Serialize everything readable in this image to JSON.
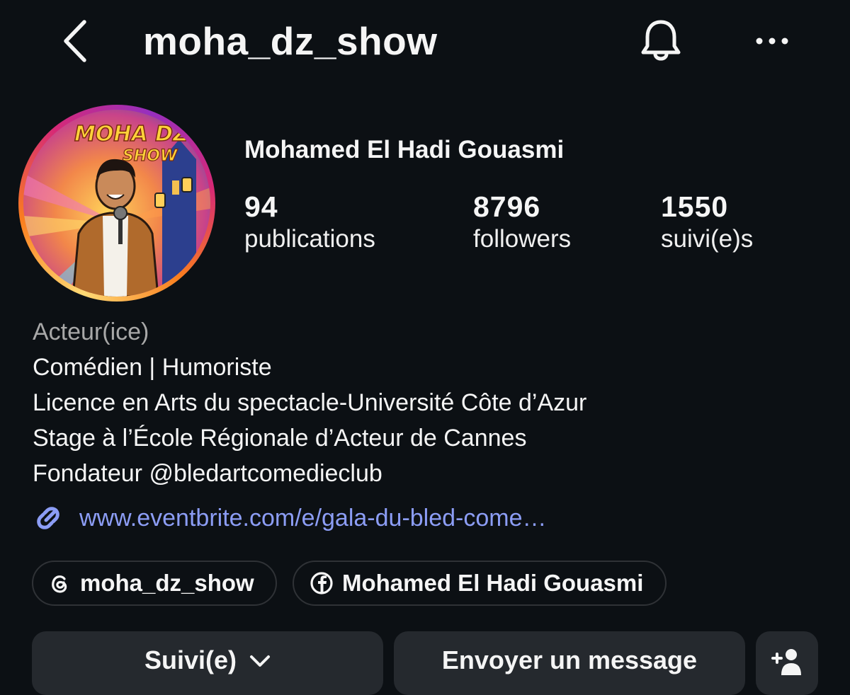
{
  "header": {
    "username": "moha_dz_show",
    "back_icon": "chevron-left-icon",
    "bell_icon": "bell-icon",
    "more_icon": "more-horizontal-icon"
  },
  "profile": {
    "avatar": {
      "text_line1": "MOHA DZ",
      "text_line2": "SHOW"
    },
    "full_name": "Mohamed El Hadi Gouasmi",
    "stats": {
      "posts": {
        "count": "94",
        "label": "publications"
      },
      "followers": {
        "count": "8796",
        "label": "followers"
      },
      "following": {
        "count": "1550",
        "label": "suivi(e)s"
      }
    },
    "bio": {
      "category": "Acteur(ice)",
      "lines": [
        "Comédien | Humoriste",
        "Licence en Arts du spectacle-Université Côte d’Azur",
        "Stage à l’École Régionale d’Acteur de Cannes",
        "Fondateur @bledartcomedieclub"
      ]
    },
    "link": {
      "text": "www.eventbrite.com/e/gala-du-bled-come…",
      "icon": "link-icon"
    },
    "social": {
      "threads": {
        "label": "moha_dz_show",
        "icon": "threads-icon"
      },
      "facebook": {
        "label": "Mohamed El Hadi Gouasmi",
        "icon": "facebook-icon"
      }
    }
  },
  "actions": {
    "following_label": "Suivi(e)",
    "message_label": "Envoyer un message",
    "add_user_icon": "add-user-icon"
  },
  "colors": {
    "background": "#0c1014",
    "text": "#f5f5f5",
    "muted": "#a8a8a8",
    "link": "#8c9df5",
    "button_bg": "#25292e"
  }
}
